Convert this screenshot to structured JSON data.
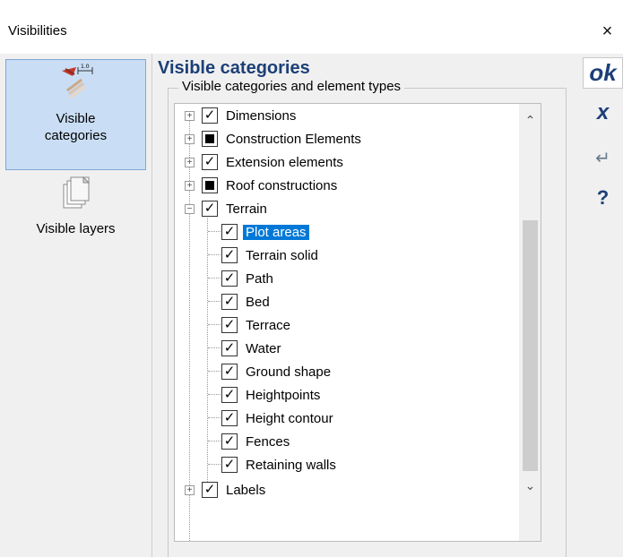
{
  "window": {
    "title": "Visibilities",
    "close_glyph": "×"
  },
  "sidebar": {
    "items": [
      {
        "label_line1": "Visible",
        "label_line2": "categories",
        "icon": "visible-categories-icon",
        "selected": true
      },
      {
        "label": "Visible layers",
        "icon": "visible-layers-icon",
        "selected": false
      }
    ]
  },
  "main": {
    "heading": "Visible categories",
    "group_label": "Visible categories and element types",
    "tree": [
      {
        "label": "Dimensions",
        "state": "checked",
        "level": 0,
        "expander": "+"
      },
      {
        "label": "Construction Elements",
        "state": "partial",
        "level": 0,
        "expander": "+"
      },
      {
        "label": "Extension elements",
        "state": "checked",
        "level": 0,
        "expander": "+"
      },
      {
        "label": "Roof constructions",
        "state": "partial",
        "level": 0,
        "expander": "+"
      },
      {
        "label": "Terrain",
        "state": "checked",
        "level": 0,
        "expander": "−"
      },
      {
        "label": "Plot areas",
        "state": "checked",
        "level": 1,
        "selected": true
      },
      {
        "label": "Terrain solid",
        "state": "checked",
        "level": 1
      },
      {
        "label": "Path",
        "state": "checked",
        "level": 1
      },
      {
        "label": "Bed",
        "state": "checked",
        "level": 1
      },
      {
        "label": "Terrace",
        "state": "checked",
        "level": 1
      },
      {
        "label": "Water",
        "state": "checked",
        "level": 1
      },
      {
        "label": "Ground shape",
        "state": "checked",
        "level": 1
      },
      {
        "label": "Heightpoints",
        "state": "checked",
        "level": 1
      },
      {
        "label": "Height contour",
        "state": "checked",
        "level": 1
      },
      {
        "label": "Fences",
        "state": "checked",
        "level": 1
      },
      {
        "label": "Retaining walls",
        "state": "checked",
        "level": 1
      },
      {
        "label": "Labels",
        "state": "checked",
        "level": 0,
        "expander": "+"
      }
    ],
    "scroll_up": "⌃",
    "scroll_down": "⌄"
  },
  "actions": {
    "ok": "ok",
    "cancel": "x",
    "apply": "↵",
    "help": "?"
  },
  "colors": {
    "accent": "#1c3f77",
    "selection": "#0078d7",
    "sidebar_selected": "#c9def5"
  }
}
